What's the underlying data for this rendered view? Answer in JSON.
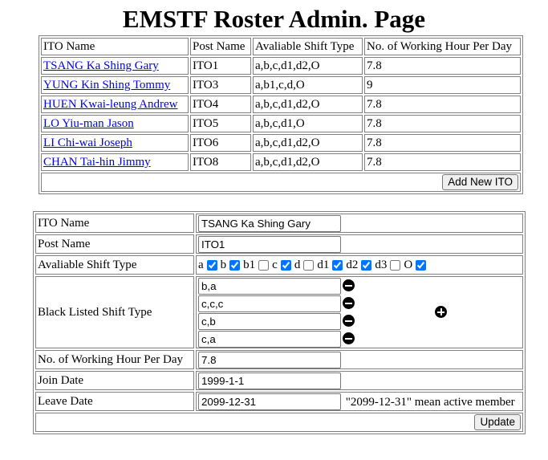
{
  "page": {
    "title": "EMSTF Roster Admin. Page"
  },
  "roster": {
    "headers": {
      "ito_name": "ITO Name",
      "post_name": "Post Name",
      "shift_type": "Avaliable Shift Type",
      "hours": "No. of Working Hour Per Day"
    },
    "rows": [
      {
        "name": "TSANG Ka Shing Gary",
        "post": "ITO1",
        "shifts": "a,b,c,d1,d2,O",
        "hours": "7.8"
      },
      {
        "name": "YUNG Kin Shing Tommy",
        "post": "ITO3",
        "shifts": "a,b1,c,d,O",
        "hours": "9"
      },
      {
        "name": "HUEN Kwai-leung Andrew",
        "post": "ITO4",
        "shifts": "a,b,c,d1,d2,O",
        "hours": "7.8"
      },
      {
        "name": "LO Yiu-man Jason",
        "post": "ITO5",
        "shifts": "a,b,c,d1,O",
        "hours": "7.8"
      },
      {
        "name": "LI Chi-wai Joseph",
        "post": "ITO6",
        "shifts": "a,b,c,d1,d2,O",
        "hours": "7.8"
      },
      {
        "name": "CHAN Tai-hin Jimmy",
        "post": "ITO8",
        "shifts": "a,b,c,d1,d2,O",
        "hours": "7.8"
      }
    ],
    "add_button": "Add New ITO"
  },
  "editor": {
    "labels": {
      "ito_name": "ITO Name",
      "post_name": "Post Name",
      "shift_type": "Avaliable Shift Type",
      "black_listed": "Black Listed Shift Type",
      "hours": "No. of Working Hour Per Day",
      "join_date": "Join Date",
      "leave_date": "Leave Date"
    },
    "values": {
      "ito_name": "TSANG Ka Shing Gary",
      "post_name": "ITO1",
      "hours": "7.8",
      "join_date": "1999-1-1",
      "leave_date": "2099-12-31"
    },
    "shift_options": [
      {
        "label": "a",
        "checked": true
      },
      {
        "label": "b",
        "checked": true
      },
      {
        "label": "b1",
        "checked": false
      },
      {
        "label": "c",
        "checked": true
      },
      {
        "label": "d",
        "checked": false
      },
      {
        "label": "d1",
        "checked": true
      },
      {
        "label": "d2",
        "checked": true
      },
      {
        "label": "d3",
        "checked": false
      },
      {
        "label": "O",
        "checked": true
      }
    ],
    "black_listed": [
      "b,a",
      "c,c,c",
      "c,b",
      "c,a"
    ],
    "leave_note": "\"2099-12-31\" mean active member",
    "update_button": "Update"
  },
  "icons": {
    "remove": "minus-circle-icon",
    "add": "plus-circle-icon"
  },
  "colors": {
    "link": "#0000ee",
    "checkbox": "#0075ff"
  }
}
